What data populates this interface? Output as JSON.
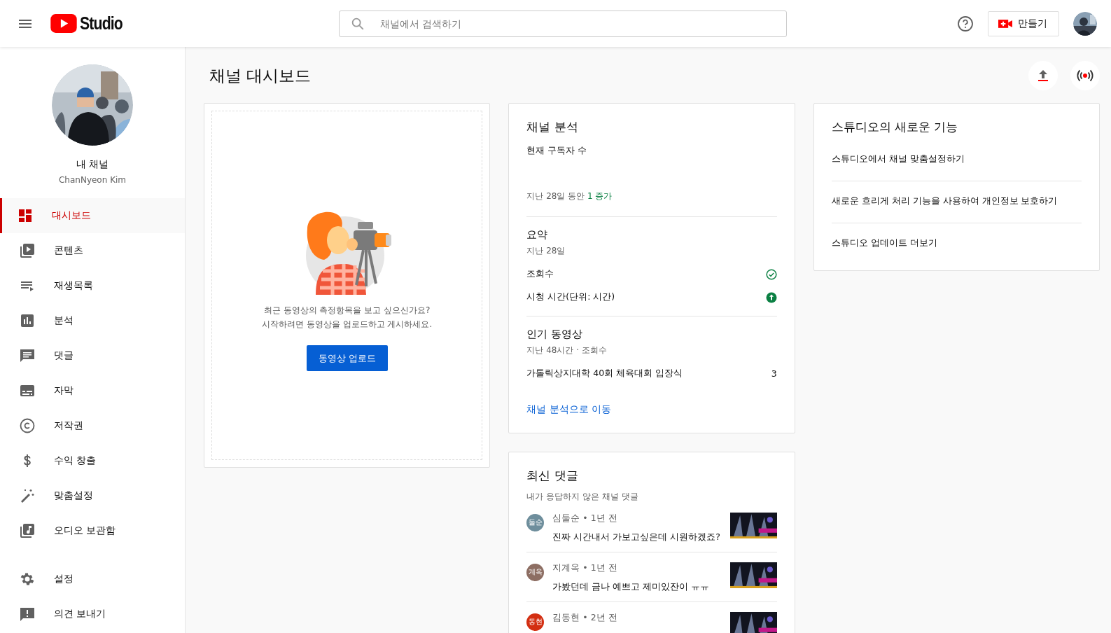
{
  "header": {
    "logo_text": "Studio",
    "search": {
      "placeholder": "채널에서 검색하기"
    },
    "create_button": "만들기"
  },
  "channel": {
    "title": "내 채널",
    "name": "ChanNyeon Kim"
  },
  "sidebar": {
    "items": [
      {
        "label": "대시보드",
        "selected": true
      },
      {
        "label": "콘텐츠",
        "selected": false
      },
      {
        "label": "재생목록",
        "selected": false
      },
      {
        "label": "분석",
        "selected": false
      },
      {
        "label": "댓글",
        "selected": false
      },
      {
        "label": "자막",
        "selected": false
      },
      {
        "label": "저작권",
        "selected": false
      },
      {
        "label": "수익 창출",
        "selected": false
      },
      {
        "label": "맞춤설정",
        "selected": false
      },
      {
        "label": "오디오 보관함",
        "selected": false
      }
    ],
    "bottom_items": [
      {
        "label": "설정",
        "selected": false
      },
      {
        "label": "의견 보내기",
        "selected": false
      }
    ]
  },
  "page": {
    "title": "채널 대시보드"
  },
  "upload_card": {
    "lines": [
      "최근 동영상의 측정항목을 보고 싶으신가요?",
      "시작하려면 동영상을 업로드하고 게시하세요."
    ],
    "button": "동영상 업로드"
  },
  "analytics_card": {
    "title": "채널 분석",
    "subscribers_label": "현재 구독자 수",
    "change": "지난 28일 동안 **1 증가**",
    "summary": {
      "title": "요약",
      "period": "지난 28일",
      "rows": [
        {
          "label": "조회수",
          "kind": "check"
        },
        {
          "label": "시청 시간(단위: 시간)",
          "kind": "up"
        }
      ]
    },
    "top_videos": {
      "title": "인기 동영상",
      "period": "지난 48시간 · 조회수",
      "rows": [
        {
          "title": "가톨릭상지대학 40회 체육대회 입장식",
          "views": "3"
        }
      ]
    },
    "link": "채널 분석으로 이동"
  },
  "comments_card": {
    "title": "최신 댓글",
    "subtitle": "내가 응답하지 않은 채널 댓글",
    "comments": [
      {
        "avatar": "둘순",
        "color": "#6e8e9c",
        "author": "심둘순 • 1년 전",
        "text": "진짜 시간내서 가보고싶은데 시원하겠죠?"
      },
      {
        "avatar": "계옥",
        "color": "#8d6e63",
        "author": "지계옥 • 1년 전",
        "text": "가봤던데 금나 예쁘고 제미있잔이 ㅠㅠ"
      },
      {
        "avatar": "동현",
        "color": "#d32f12",
        "author": "김동현 • 2년 전"
      }
    ]
  },
  "news_card": {
    "title": "스튜디오의 새로운 기능",
    "items": [
      "스튜디오에서 채널 맞춤설정하기",
      "새로운 흐리게 처리 기능을 사용하여 개인정보 보호하기",
      "스튜디오 업데이트 더보기"
    ]
  }
}
